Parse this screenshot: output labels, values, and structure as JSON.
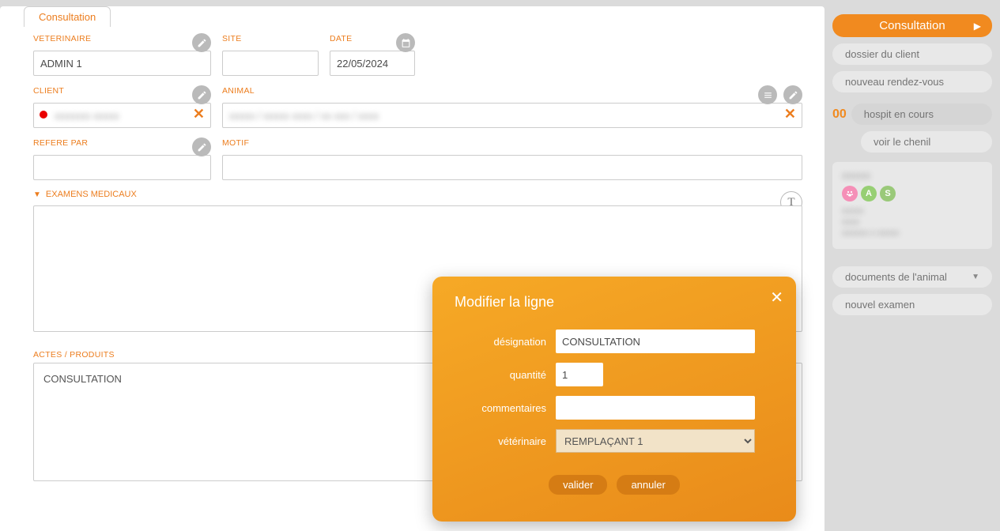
{
  "tab": {
    "label": "Consultation"
  },
  "fields": {
    "veterinaire": {
      "label": "VETERINAIRE",
      "value": "ADMIN 1"
    },
    "site": {
      "label": "SITE",
      "value": ""
    },
    "date": {
      "label": "DATE",
      "value": "22/05/2024"
    },
    "client": {
      "label": "CLIENT",
      "value_masked": "xxxxxxx xxxxx"
    },
    "animal": {
      "label": "ANIMAL",
      "value_masked": "xxxxx / xxxxx xxxx / xx xxx / xxxx"
    },
    "refere": {
      "label": "REFERE PAR",
      "value": ""
    },
    "motif": {
      "label": "MOTIF",
      "value": ""
    }
  },
  "sections": {
    "examens": {
      "label": "EXAMENS MEDICAUX",
      "text": ""
    },
    "actes": {
      "label": "ACTES / PRODUITS",
      "items": [
        "CONSULTATION"
      ]
    }
  },
  "modal": {
    "title": "Modifier la ligne",
    "labels": {
      "designation": "désignation",
      "quantite": "quantité",
      "commentaires": "commentaires",
      "veterinaire": "vétérinaire"
    },
    "values": {
      "designation": "CONSULTATION",
      "quantite": "1",
      "commentaires": "",
      "veterinaire_selected": "REMPLAÇANT 1"
    },
    "buttons": {
      "valider": "valider",
      "annuler": "annuler"
    }
  },
  "sidebar": {
    "consultation": "Consultation",
    "dossier_client": "dossier du client",
    "nouveau_rdv": "nouveau rendez-vous",
    "hospit_count": "00",
    "hospit_en_cours": "hospit en cours",
    "voir_chenil": "voir le chenil",
    "documents_animal": "documents de l'animal",
    "nouvel_examen": "nouvel examen",
    "badges": {
      "a": "A",
      "s": "S"
    },
    "patient_name_masked": "xxxxxx",
    "patient_line1_masked": "xxxxx",
    "patient_line2_masked": "xxxx",
    "patient_line3_masked": "xxxxxx x xxxxx"
  }
}
